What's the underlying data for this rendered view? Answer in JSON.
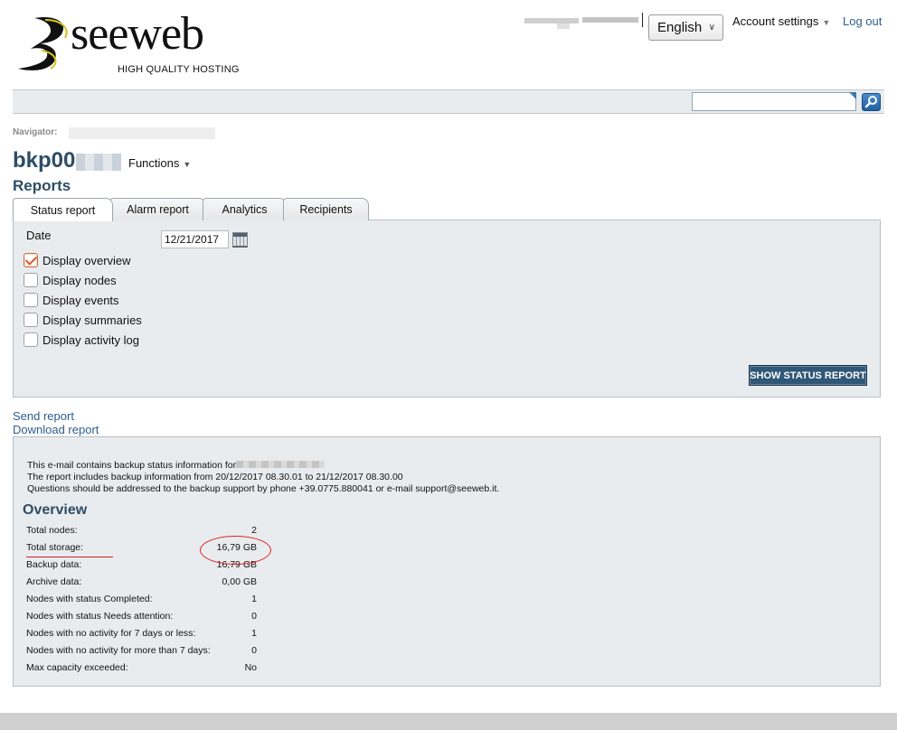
{
  "header": {
    "logo": {
      "word": "seeweb",
      "tagline": "HIGH QUALITY HOSTING"
    },
    "language": "English",
    "account_settings": "Account settings",
    "logout": "Log out"
  },
  "search": {
    "placeholder": ""
  },
  "navigator": {
    "label": "Navigator:"
  },
  "node": {
    "name_prefix": "bkp00",
    "functions": "Functions"
  },
  "section_title": "Reports",
  "tabs": [
    {
      "label": "Status report",
      "active": true
    },
    {
      "label": "Alarm report",
      "active": false
    },
    {
      "label": "Analytics",
      "active": false
    },
    {
      "label": "Recipients",
      "active": false
    }
  ],
  "form": {
    "date_label": "Date",
    "date_value": "12/21/2017",
    "options": [
      {
        "label": "Display overview",
        "checked": true
      },
      {
        "label": "Display nodes",
        "checked": false
      },
      {
        "label": "Display events",
        "checked": false
      },
      {
        "label": "Display summaries",
        "checked": false
      },
      {
        "label": "Display activity log",
        "checked": false
      }
    ],
    "submit_label": "SHOW STATUS REPORT"
  },
  "links": {
    "send": "Send report",
    "download": "Download report"
  },
  "report": {
    "intro_line1": "This e-mail contains backup status information for",
    "intro_line2": "The report includes backup information from 20/12/2017 08.30.01 to 21/12/2017 08.30.00",
    "intro_line3": "Questions should be addressed to the backup support by phone +39.0775.880041 or e-mail support@seeweb.it.",
    "overview_title": "Overview",
    "rows": [
      {
        "label": "Total nodes:",
        "value": "2"
      },
      {
        "label": "Total storage:",
        "value": "16,79 GB"
      },
      {
        "label": "Backup data:",
        "value": "16,79 GB"
      },
      {
        "label": "Archive data:",
        "value": "0,00 GB"
      },
      {
        "label": "Nodes with status Completed:",
        "value": "1"
      },
      {
        "label": "Nodes with status Needs attention:",
        "value": "0"
      },
      {
        "label": "Nodes with no activity for 7 days or less:",
        "value": "1"
      },
      {
        "label": "Nodes with no activity for more than 7 days:",
        "value": "0"
      },
      {
        "label": "Max capacity exceeded:",
        "value": "No"
      }
    ]
  },
  "colors": {
    "accent": "#2e4d66",
    "link": "#2d5d8f",
    "button": "#2f5777",
    "annotation": "#dd2222"
  }
}
